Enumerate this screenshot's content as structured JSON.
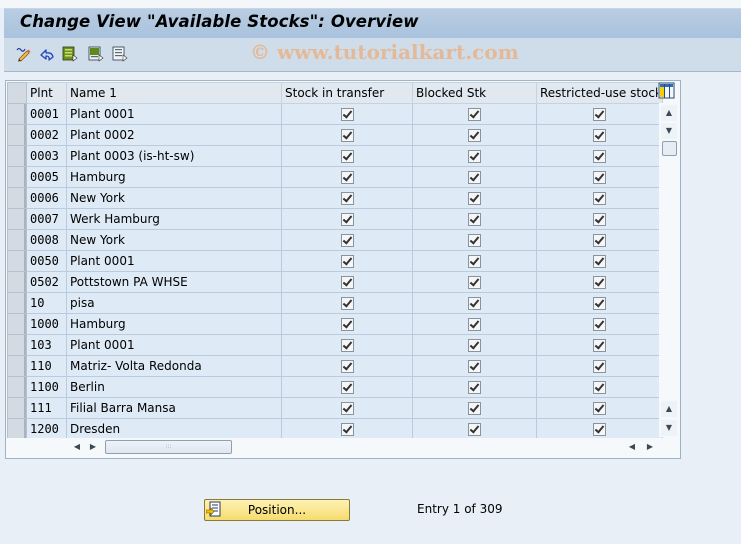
{
  "window": {
    "title": "Change View \"Available Stocks\": Overview"
  },
  "watermark": "© www.tutorialkart.com",
  "toolbar": {
    "icons": [
      "display-change-icon",
      "undo-icon",
      "select-all-icon",
      "select-block-icon",
      "deselect-all-icon"
    ]
  },
  "table": {
    "columns": [
      "Plnt",
      "Name 1",
      "Stock in transfer",
      "Blocked Stk",
      "Restricted-use stock"
    ],
    "rows": [
      {
        "plnt": "0001",
        "name": "Plant 0001",
        "stock_in_transfer": true,
        "blocked": true,
        "restricted": true
      },
      {
        "plnt": "0002",
        "name": "Plant 0002",
        "stock_in_transfer": true,
        "blocked": true,
        "restricted": true
      },
      {
        "plnt": "0003",
        "name": "Plant 0003 (is-ht-sw)",
        "stock_in_transfer": true,
        "blocked": true,
        "restricted": true
      },
      {
        "plnt": "0005",
        "name": "Hamburg",
        "stock_in_transfer": true,
        "blocked": true,
        "restricted": true
      },
      {
        "plnt": "0006",
        "name": "New York",
        "stock_in_transfer": true,
        "blocked": true,
        "restricted": true
      },
      {
        "plnt": "0007",
        "name": "Werk Hamburg",
        "stock_in_transfer": true,
        "blocked": true,
        "restricted": true
      },
      {
        "plnt": "0008",
        "name": "New York",
        "stock_in_transfer": true,
        "blocked": true,
        "restricted": true
      },
      {
        "plnt": "0050",
        "name": "Plant 0001",
        "stock_in_transfer": true,
        "blocked": true,
        "restricted": true
      },
      {
        "plnt": "0502",
        "name": "Pottstown PA WHSE",
        "stock_in_transfer": true,
        "blocked": true,
        "restricted": true
      },
      {
        "plnt": "10",
        "name": "pisa",
        "stock_in_transfer": true,
        "blocked": true,
        "restricted": true
      },
      {
        "plnt": "1000",
        "name": "Hamburg",
        "stock_in_transfer": true,
        "blocked": true,
        "restricted": true
      },
      {
        "plnt": "103",
        "name": "Plant 0001",
        "stock_in_transfer": true,
        "blocked": true,
        "restricted": true
      },
      {
        "plnt": "110",
        "name": "Matriz- Volta Redonda",
        "stock_in_transfer": true,
        "blocked": true,
        "restricted": true
      },
      {
        "plnt": "1100",
        "name": "Berlin",
        "stock_in_transfer": true,
        "blocked": true,
        "restricted": true
      },
      {
        "plnt": "111",
        "name": "Filial Barra Mansa",
        "stock_in_transfer": true,
        "blocked": true,
        "restricted": true
      },
      {
        "plnt": "1200",
        "name": "Dresden",
        "stock_in_transfer": true,
        "blocked": true,
        "restricted": true
      }
    ]
  },
  "footer": {
    "position_button": "Position...",
    "entry_text": "Entry 1 of 309"
  }
}
